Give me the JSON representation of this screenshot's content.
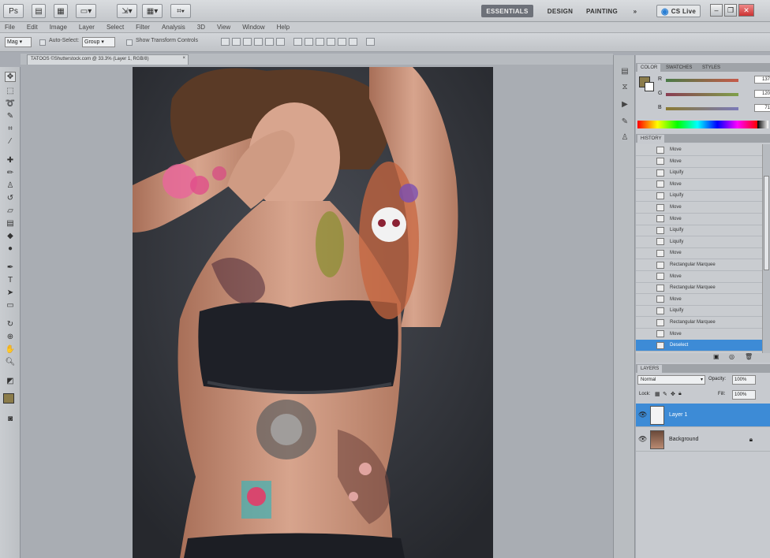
{
  "appbar": {
    "icons": [
      "Ps",
      "bridge-icon",
      "mini-bridge-icon",
      "screen-mode-icon",
      "hand-tool-icon",
      "zoom-tool-icon",
      "arrange-icon",
      "screen-arrange-icon"
    ],
    "workspaces": [
      "ESSENTIALS",
      "DESIGN",
      "PAINTING",
      "»"
    ],
    "cslive_label": "CS Live"
  },
  "menubar": [
    "File",
    "Edit",
    "Image",
    "Layer",
    "Select",
    "Filter",
    "Analysis",
    "3D",
    "View",
    "Window",
    "Help"
  ],
  "options": {
    "tool_icon": "Mag",
    "auto_select_label": "Auto-Select:",
    "auto_select_value": "Group",
    "transform_label": "Show Transform Controls"
  },
  "document": {
    "tab_title": "TATOOS ©Shutterstock.com @ 33.3% (Layer 1, RGB/8)"
  },
  "color_panel": {
    "tabs": [
      "COLOR",
      "SWATCHES",
      "STYLES"
    ],
    "channels": [
      {
        "label": "R",
        "value": "137"
      },
      {
        "label": "G",
        "value": "120"
      },
      {
        "label": "B",
        "value": "71"
      }
    ],
    "foreground": "#8b7c4a"
  },
  "history": {
    "tab": "HISTORY",
    "items": [
      "Move",
      "Move",
      "Liquify",
      "Move",
      "Liquify",
      "Move",
      "Move",
      "Liquify",
      "Liquify",
      "Move",
      "Rectangular Marquee",
      "Move",
      "Rectangular Marquee",
      "Move",
      "Liquify",
      "Rectangular Marquee",
      "Move",
      "Deselect"
    ],
    "selected_index": 17
  },
  "layers": {
    "tab": "LAYERS",
    "mode": "Normal",
    "opacity_label": "Opacity:",
    "opacity": "100%",
    "lock_label": "Lock:",
    "fill_label": "Fill:",
    "fill": "100%",
    "rows": [
      {
        "name": "Layer 1",
        "selected": true
      },
      {
        "name": "Background",
        "selected": false
      }
    ]
  }
}
